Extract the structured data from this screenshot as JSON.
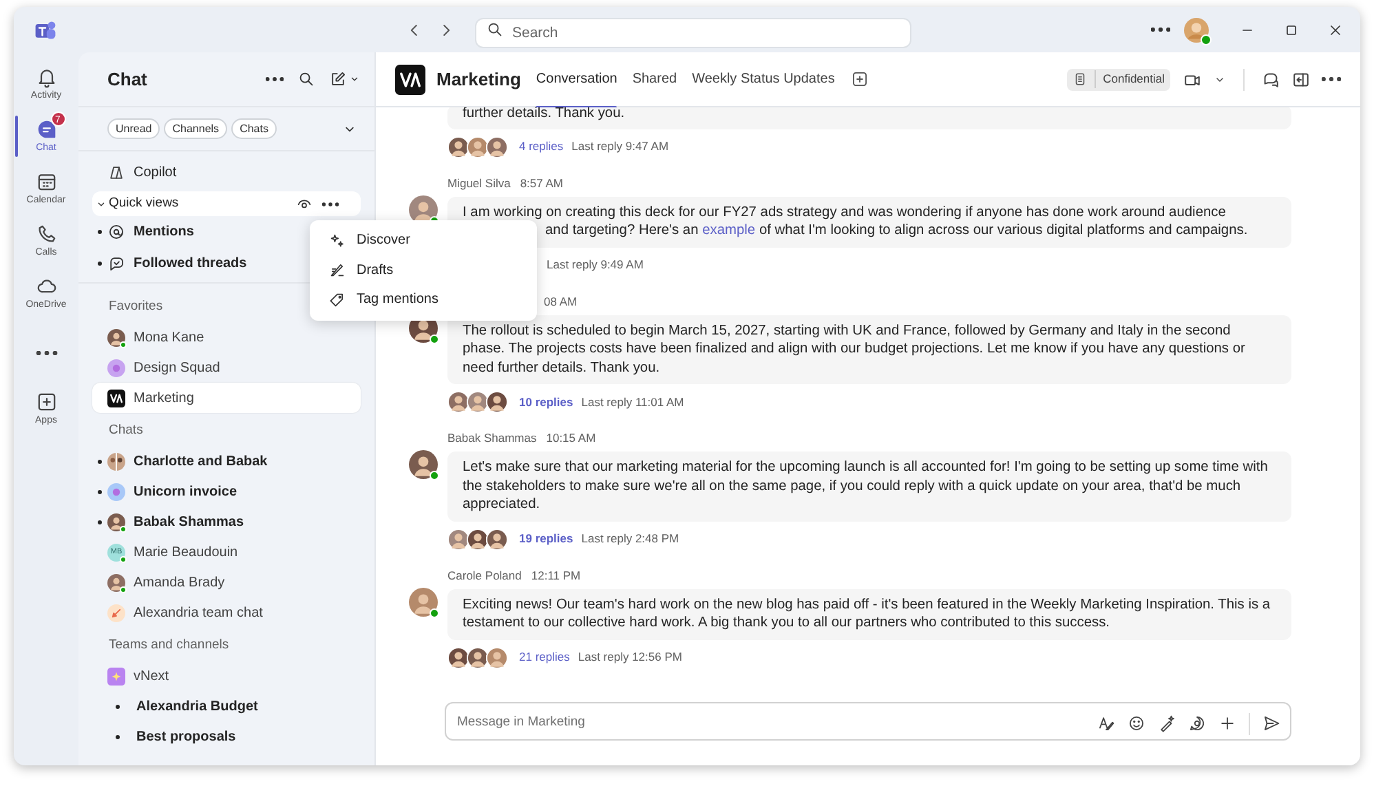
{
  "rail": [
    {
      "label": "Activity",
      "kind": "bell",
      "selected": false
    },
    {
      "label": "Chat",
      "kind": "chat",
      "selected": true,
      "badge": "7"
    },
    {
      "label": "Calendar",
      "kind": "calendar",
      "selected": false
    },
    {
      "label": "Calls",
      "kind": "phone",
      "selected": false
    },
    {
      "label": "OneDrive",
      "kind": "cloud",
      "selected": false
    },
    {
      "kind": "more",
      "selected": false
    },
    {
      "label": "Apps",
      "kind": "apps",
      "selected": false
    }
  ],
  "title_bar": {
    "search_placeholder": "Search",
    "user_online": true
  },
  "sidebar": {
    "title": "Chat",
    "filters": [
      "Unread",
      "Channels",
      "Chats"
    ],
    "copilot": "Copilot",
    "quick_views": {
      "label": "Quick views",
      "expanded": true,
      "items": [
        {
          "label": "Mentions",
          "kind": "mention",
          "unread": true
        },
        {
          "label": "Followed threads",
          "kind": "threads",
          "unread": true
        }
      ]
    },
    "sections": [
      {
        "title": "Favorites",
        "items": [
          {
            "label": "Mona Kane",
            "kind": "person",
            "online": true,
            "unread": false,
            "selected": false
          },
          {
            "label": "Design Squad",
            "kind": "group",
            "unread": false,
            "selected": false
          },
          {
            "label": "Marketing",
            "kind": "logo",
            "unread": false,
            "selected": true
          }
        ]
      },
      {
        "title": "Chats",
        "items": [
          {
            "label": "Charlotte and Babak",
            "kind": "pair",
            "unread": true,
            "selected": false
          },
          {
            "label": "Unicorn invoice",
            "kind": "group",
            "unread": true,
            "selected": false
          },
          {
            "label": "Babak Shammas",
            "kind": "person",
            "online": true,
            "unread": true,
            "selected": false
          },
          {
            "label": "Marie Beaudouin",
            "kind": "initials",
            "initials": "MB",
            "online": true,
            "unread": false,
            "selected": false
          },
          {
            "label": "Amanda Brady",
            "kind": "person",
            "online": true,
            "unread": false,
            "selected": false
          },
          {
            "label": "Alexandria team chat",
            "kind": "rocket",
            "unread": false,
            "selected": false
          }
        ]
      },
      {
        "title": "Teams and channels",
        "items": [
          {
            "label": "vNext",
            "kind": "team",
            "unread": false,
            "selected": false,
            "children": [
              {
                "label": "Alexandria Budget",
                "unread": true,
                "selected": false
              },
              {
                "label": "Best proposals",
                "unread": true,
                "selected": false
              }
            ]
          }
        ]
      }
    ]
  },
  "menu": [
    {
      "label": "Discover",
      "kind": "discover"
    },
    {
      "label": "Drafts",
      "kind": "drafts"
    },
    {
      "label": "Tag mentions",
      "kind": "tag"
    }
  ],
  "channel": {
    "name": "Marketing",
    "tabs": [
      {
        "label": "Conversation",
        "selected": true
      },
      {
        "label": "Shared",
        "selected": false
      },
      {
        "label": "Weekly Status Updates",
        "selected": false
      }
    ],
    "sensitivity": "Confidential"
  },
  "messages": [
    {
      "paragraphs": [
        {
          "segments": [
            {
              "kind": "text",
              "text": "further details. Thank you."
            }
          ]
        }
      ],
      "thread": {
        "count": "4 replies",
        "unread": false,
        "last": "Last reply 9:47 AM"
      }
    },
    {
      "author": "Miguel Silva",
      "time": "8:57 AM",
      "online": true,
      "paragraphs": [
        {
          "segments": [
            {
              "kind": "text",
              "text": "I am working on creating this deck for our FY27 ads strategy and was wondering if anyone has done work around audience"
            }
          ]
        },
        {
          "partial_start": true,
          "segments": [
            {
              "kind": "text",
              "text": "and targeting? Here's an "
            },
            {
              "kind": "link",
              "text": "example"
            },
            {
              "kind": "text",
              "text": " of what I'm looking to align across our various digital platforms and campaigns."
            }
          ]
        }
      ],
      "thread": {
        "last": "Last reply 9:49 AM",
        "partial_start": true
      }
    },
    {
      "time": "08 AM",
      "header_partial": true,
      "online": true,
      "paragraphs": [
        {
          "segments": [
            {
              "kind": "text",
              "text": "The rollout is scheduled to begin March 15, 2027, starting with UK and France, followed by Germany and Italy in the second phase. The projects costs have been finalized and align with our budget projections. Let me know if you have any questions or need further details. Thank you."
            }
          ]
        }
      ],
      "thread": {
        "count": "10 replies",
        "unread": true,
        "last": "Last reply 11:01 AM"
      }
    },
    {
      "author": "Babak Shammas",
      "time": "10:15 AM",
      "online": true,
      "paragraphs": [
        {
          "segments": [
            {
              "kind": "text",
              "text": "Let's make sure that our marketing material for the upcoming launch is all accounted for! I'm going to be setting up some time with the stakeholders to make sure we're all on the same page, if you could reply with a quick update on your area, that'd be much appreciated."
            }
          ]
        }
      ],
      "thread": {
        "count": "19 replies",
        "unread": true,
        "last": "Last reply 2:48 PM"
      }
    },
    {
      "author": "Carole Poland",
      "time": "12:11 PM",
      "online": true,
      "paragraphs": [
        {
          "segments": [
            {
              "kind": "text",
              "text": "Exciting news! Our team's hard work on the new blog has paid off - it's been featured in the Weekly Marketing Inspiration. This is a testament to our collective hard work. A big thank you to all our partners who contributed to this success."
            }
          ]
        }
      ],
      "thread": {
        "count": "21 replies",
        "unread": false,
        "last": "Last reply 12:56 PM"
      }
    }
  ],
  "compose": {
    "placeholder": "Message in Marketing"
  }
}
